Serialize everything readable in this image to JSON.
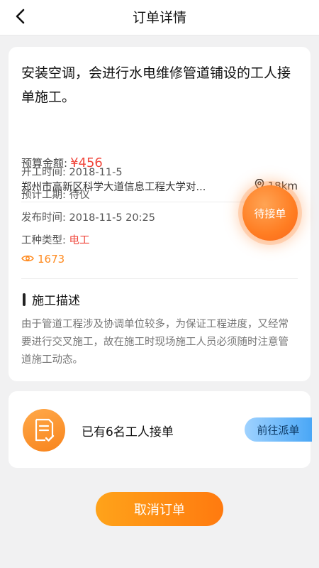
{
  "nav": {
    "title": "订单详情",
    "back_icon": "chevron-left-icon"
  },
  "order": {
    "title": "安装空调，会进行水电维修管道铺设的工人接单施工。",
    "budget_label": "预算金额:",
    "budget_value": "¥456",
    "address": "郑州市高新区科学大道信息工程大学对...",
    "distance": "18km",
    "start_label": "开工时间:",
    "start_value": "2018-11-5",
    "duration_label": "预计工期:",
    "duration_value": "待仪",
    "publish_label": "发布时间:",
    "publish_value": "2018-11-5  20:25",
    "worktype_label": "工种类型:",
    "worktype_value": "电工",
    "views": "1673",
    "status": "待接单"
  },
  "description": {
    "heading": "施工描述",
    "text": "由于管道工程涉及协调单位较多，为保证工程进度，又经常要进行交叉施工，故在施工时现场施工人员必须随时注意管道施工动态。"
  },
  "workers": {
    "text": "已有6名工人接单",
    "dispatch_label": "前往派单"
  },
  "actions": {
    "cancel_label": "取消订单"
  },
  "colors": {
    "accent_orange": "#ff8a1f",
    "price_red": "#f0473c",
    "dispatch_blue": "#4aa7f6"
  }
}
